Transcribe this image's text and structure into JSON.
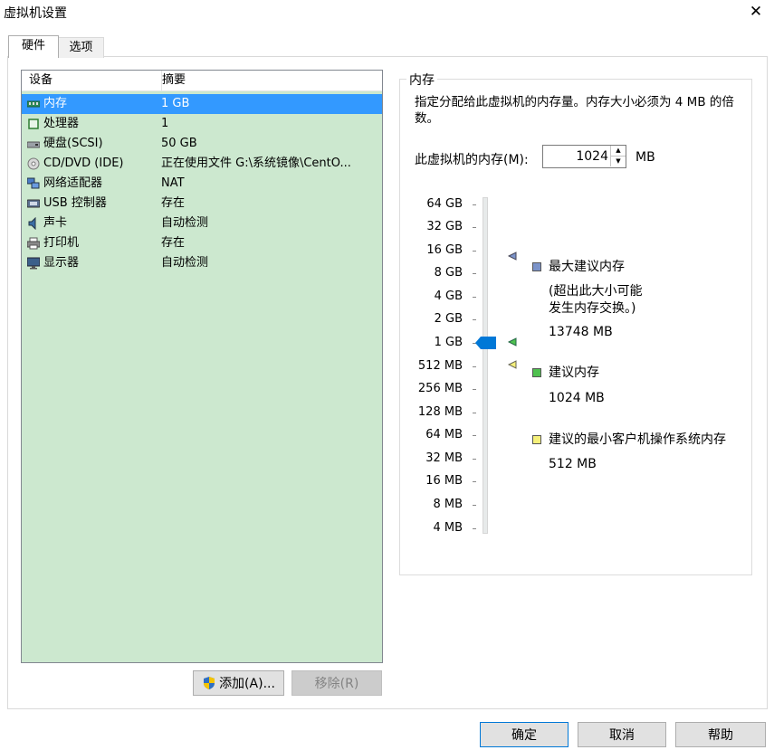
{
  "window": {
    "title": "虚拟机设置",
    "close_glyph": "✕"
  },
  "tabs": [
    {
      "label": "硬件",
      "active": true
    },
    {
      "label": "选项",
      "active": false
    }
  ],
  "device_list": {
    "headers": {
      "device": "设备",
      "summary": "摘要"
    },
    "rows": [
      {
        "name": "内存",
        "summary": "1 GB",
        "icon": "memory-icon",
        "selected": true
      },
      {
        "name": "处理器",
        "summary": "1",
        "icon": "cpu-icon"
      },
      {
        "name": "硬盘(SCSI)",
        "summary": "50 GB",
        "icon": "hard-disk-icon"
      },
      {
        "name": "CD/DVD (IDE)",
        "summary": "正在使用文件 G:\\系统镜像\\CentO...",
        "icon": "cd-dvd-icon"
      },
      {
        "name": "网络适配器",
        "summary": "NAT",
        "icon": "network-adapter-icon"
      },
      {
        "name": "USB 控制器",
        "summary": "存在",
        "icon": "usb-icon"
      },
      {
        "name": "声卡",
        "summary": "自动检测",
        "icon": "sound-card-icon"
      },
      {
        "name": "打印机",
        "summary": "存在",
        "icon": "printer-icon"
      },
      {
        "name": "显示器",
        "summary": "自动检测",
        "icon": "display-icon"
      }
    ]
  },
  "list_buttons": {
    "add": "添加(A)...",
    "remove": "移除(R)"
  },
  "memory": {
    "group_title": "内存",
    "description": "指定分配给此虚拟机的内存量。内存大小必须为 4 MB 的倍数。",
    "field_label": "此虚拟机的内存(M):",
    "value": "1024",
    "unit": "MB",
    "scale_labels": [
      "64 GB",
      "32 GB",
      "16 GB",
      "8 GB",
      "4 GB",
      "2 GB",
      "1 GB",
      "512 MB",
      "256 MB",
      "128 MB",
      "64 MB",
      "32 MB",
      "16 MB",
      "8 MB",
      "4 MB"
    ],
    "legend": {
      "max": {
        "title": "最大建议内存",
        "note": "(超出此大小可能\n发生内存交换。)",
        "value": "13748 MB",
        "color": "#7b93c9"
      },
      "recommended": {
        "title": "建议内存",
        "value": "1024 MB",
        "color": "#4fc14f"
      },
      "min_guest": {
        "title": "建议的最小客户机操作系统内存",
        "value": "512 MB",
        "color": "#f5f07a"
      }
    },
    "slider_color": "#0078d7"
  },
  "footer": {
    "ok": "确定",
    "cancel": "取消",
    "help": "帮助"
  }
}
